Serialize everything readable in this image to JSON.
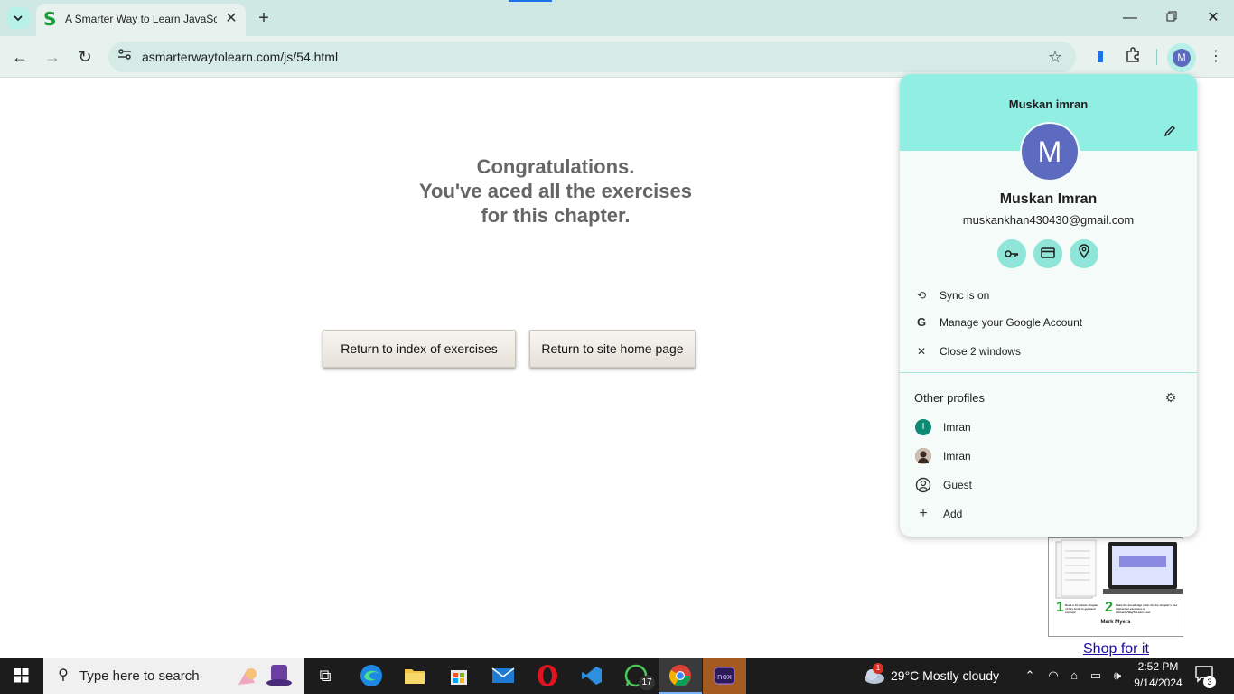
{
  "browser": {
    "tab": {
      "title": "A Smarter Way to Learn JavaScr",
      "favicon": "S"
    },
    "url": "asmarterwaytolearn.com/js/54.html",
    "profile_initial": "M"
  },
  "page": {
    "congrats_lines": [
      "Congratulations.",
      "You've aced all the exercises",
      "for this chapter."
    ],
    "buttons": {
      "index": "Return to index of exercises",
      "home": "Return to site home page"
    },
    "ad": {
      "step1": "Read a 10-minute chapter of this book to get each concept.",
      "step2": "Make the knowledge stick. Do the chapter's free interactive exercises at ASmarterWayToLearn.com.",
      "author": "Mark Myers",
      "num1": "1",
      "num2": "2"
    },
    "shop_link": "Shop for it"
  },
  "profile_menu": {
    "header_name": "Muskan imran",
    "avatar_initial": "M",
    "name": "Muskan Imran",
    "email": "muskankhan430430@gmail.com",
    "quick_icons": [
      "key-icon",
      "credit-card-icon",
      "location-pin-icon"
    ],
    "items": [
      {
        "icon": "sync-icon",
        "label": "Sync is on"
      },
      {
        "icon": "google-g-icon",
        "label": "Manage your Google Account"
      },
      {
        "icon": "close-icon",
        "label": "Close 2 windows"
      }
    ],
    "other_profiles_title": "Other profiles",
    "profiles": [
      {
        "initial": "I",
        "label": "Imran"
      },
      {
        "initial": "",
        "label": "Imran"
      },
      {
        "initial": "",
        "label": "Guest"
      },
      {
        "initial": "",
        "label": "Add"
      }
    ]
  },
  "taskbar": {
    "search_placeholder": "Type here to search",
    "whatsapp_badge": "17",
    "weather": "29°C  Mostly cloudy",
    "weather_badge": "1",
    "time": "2:52 PM",
    "date": "9/14/2024",
    "notification_count": "3",
    "colors": {
      "accent_teal": "#90efe2",
      "avatar_indigo": "#5c6bc0"
    }
  }
}
